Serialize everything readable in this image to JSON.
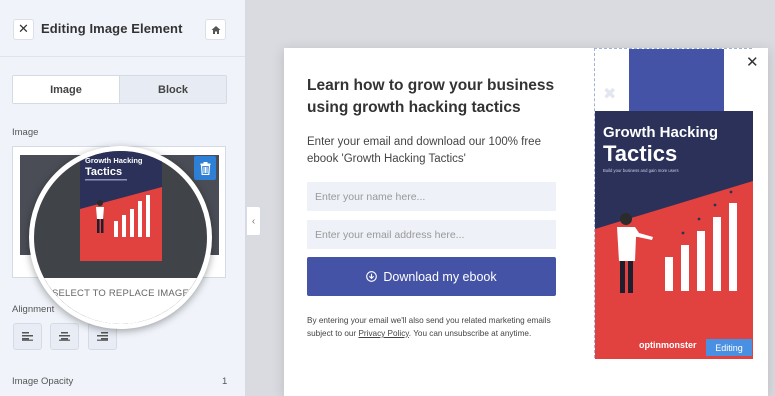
{
  "sidebar": {
    "title": "Editing Image Element",
    "tabs": [
      {
        "label": "Image",
        "active": true
      },
      {
        "label": "Block",
        "active": false
      }
    ],
    "image_label": "Image",
    "replace_caption": "SELECT TO REPLACE IMAGE",
    "alignment_label": "Alignment",
    "opacity_label": "Image Opacity",
    "opacity_value": "1"
  },
  "popup": {
    "heading": "Learn how to grow your business using growth hacking tactics",
    "text": "Enter your email and download our 100% free ebook 'Growth Hacking Tactics'",
    "name_placeholder": "Enter your name here...",
    "email_placeholder": "Enter your email address here...",
    "button_label": "Download my ebook",
    "disclaimer_before": "By entering your email we'll also send you related marketing emails subject to our ",
    "privacy_link": "Privacy Policy",
    "disclaimer_after": ". You can unsubscribe at anytime.",
    "editing_badge": "Editing"
  },
  "book": {
    "title_line1": "Growth Hacking",
    "title_line2": "Tactics",
    "subtitle": "Build your business and gain more users",
    "brand": "optinmonster"
  },
  "colors": {
    "accent_blue": "#2e7fd6",
    "button": "#4453a6",
    "book_dark": "#2b3158",
    "book_red": "#e2423f",
    "book_stripe": "#4453a6"
  }
}
